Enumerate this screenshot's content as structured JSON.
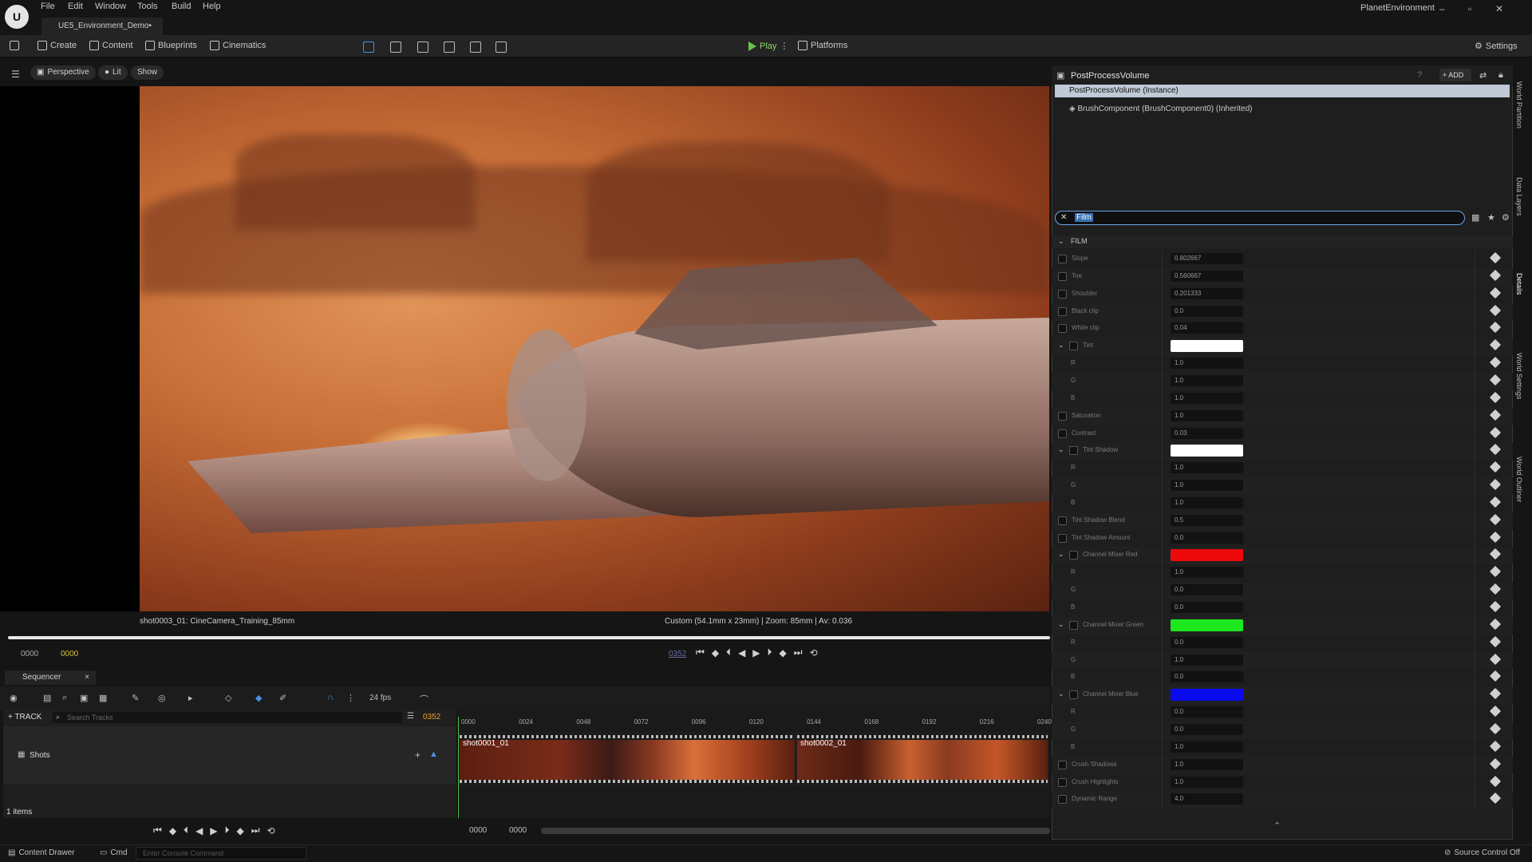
{
  "menu": [
    "File",
    "Edit",
    "Window",
    "Tools",
    "Build",
    "Help"
  ],
  "project_tab": "UE5_Environment_Demo•",
  "project_name": "PlanetEnvironment",
  "toolbar": {
    "create": "Create",
    "content": "Content",
    "blueprints": "Blueprints",
    "cinematics": "Cinematics",
    "play": "Play",
    "platforms": "Platforms",
    "settings": "Settings"
  },
  "viewport": {
    "perspective": "Perspective",
    "lit": "Lit",
    "show": "Show",
    "camera_label": "shot0003_01: CineCamera_Training_85mm",
    "camera_info": "Custom (54.1mm x 23mm) | Zoom: 85mm | Av: 0.036",
    "frame_start": "0000",
    "frame_current": "0000",
    "frame_end": "0352"
  },
  "sequencer": {
    "tab": "Sequencer",
    "fps": "24 fps",
    "track_button": "TRACK",
    "search_placeholder": "Search Tracks",
    "frame_marker": "0352",
    "track_name": "Shots",
    "items_count": "1 items",
    "bottom_start": "0000",
    "bottom_end": "0000",
    "ruler": [
      "0000",
      "0024",
      "0048",
      "0072",
      "0096",
      "0120",
      "0144",
      "0168",
      "0192",
      "0216",
      "0240"
    ],
    "clips": [
      {
        "name": "shot0001_01"
      },
      {
        "name": "shot0002_01"
      }
    ]
  },
  "details": {
    "title": "PostProcessVolume",
    "add_label": "ADD",
    "instance": "PostProcessVolume (Instance)",
    "component": "BrushComponent (BrushComponent0) (Inherited)",
    "search_value": "Film",
    "section": "FILM",
    "rows": [
      {
        "label": "Slope",
        "value": "0.802667"
      },
      {
        "label": "Toe",
        "value": "0.560667"
      },
      {
        "label": "Shoulder",
        "value": "0.201333"
      },
      {
        "label": "Black clip",
        "value": "0.0"
      },
      {
        "label": "White clip",
        "value": "0.04"
      },
      {
        "label": "Tint",
        "color": "#ffffff",
        "group": true
      },
      {
        "label": "R",
        "value": "1.0",
        "sub": true
      },
      {
        "label": "G",
        "value": "1.0",
        "sub": true
      },
      {
        "label": "B",
        "value": "1.0",
        "sub": true
      },
      {
        "label": "Saturation",
        "value": "1.0"
      },
      {
        "label": "Contrast",
        "value": "0.03"
      },
      {
        "label": "Tint Shadow",
        "color": "#ffffff",
        "group": true
      },
      {
        "label": "R",
        "value": "1.0",
        "sub": true
      },
      {
        "label": "G",
        "value": "1.0",
        "sub": true
      },
      {
        "label": "B",
        "value": "1.0",
        "sub": true
      },
      {
        "label": "Tint Shadow Blend",
        "value": "0.5"
      },
      {
        "label": "Tint Shadow Amount",
        "value": "0.0"
      },
      {
        "label": "Channel Mixer Red",
        "color": "#ee0a0a",
        "group": true
      },
      {
        "label": "R",
        "value": "1.0",
        "sub": true
      },
      {
        "label": "G",
        "value": "0.0",
        "sub": true
      },
      {
        "label": "B",
        "value": "0.0",
        "sub": true
      },
      {
        "label": "Channel Mixer Green",
        "color": "#1ee81e",
        "group": true
      },
      {
        "label": "R",
        "value": "0.0",
        "sub": true
      },
      {
        "label": "G",
        "value": "1.0",
        "sub": true
      },
      {
        "label": "B",
        "value": "0.0",
        "sub": true
      },
      {
        "label": "Channel Mixer Blue",
        "color": "#0a0aee",
        "group": true
      },
      {
        "label": "R",
        "value": "0.0",
        "sub": true
      },
      {
        "label": "G",
        "value": "0.0",
        "sub": true
      },
      {
        "label": "B",
        "value": "1.0",
        "sub": true
      },
      {
        "label": "Crush Shadows",
        "value": "1.0"
      },
      {
        "label": "Crush Highlights",
        "value": "1.0"
      },
      {
        "label": "Dynamic Range",
        "value": "4.0"
      }
    ]
  },
  "side_tabs": [
    "World Partition",
    "Data Layers",
    "Details",
    "World Settings",
    "World Outliner"
  ],
  "status": {
    "content_drawer": "Content Drawer",
    "cmd": "Cmd",
    "console_placeholder": "Enter Console Command",
    "source_control": "Source Control Off"
  }
}
